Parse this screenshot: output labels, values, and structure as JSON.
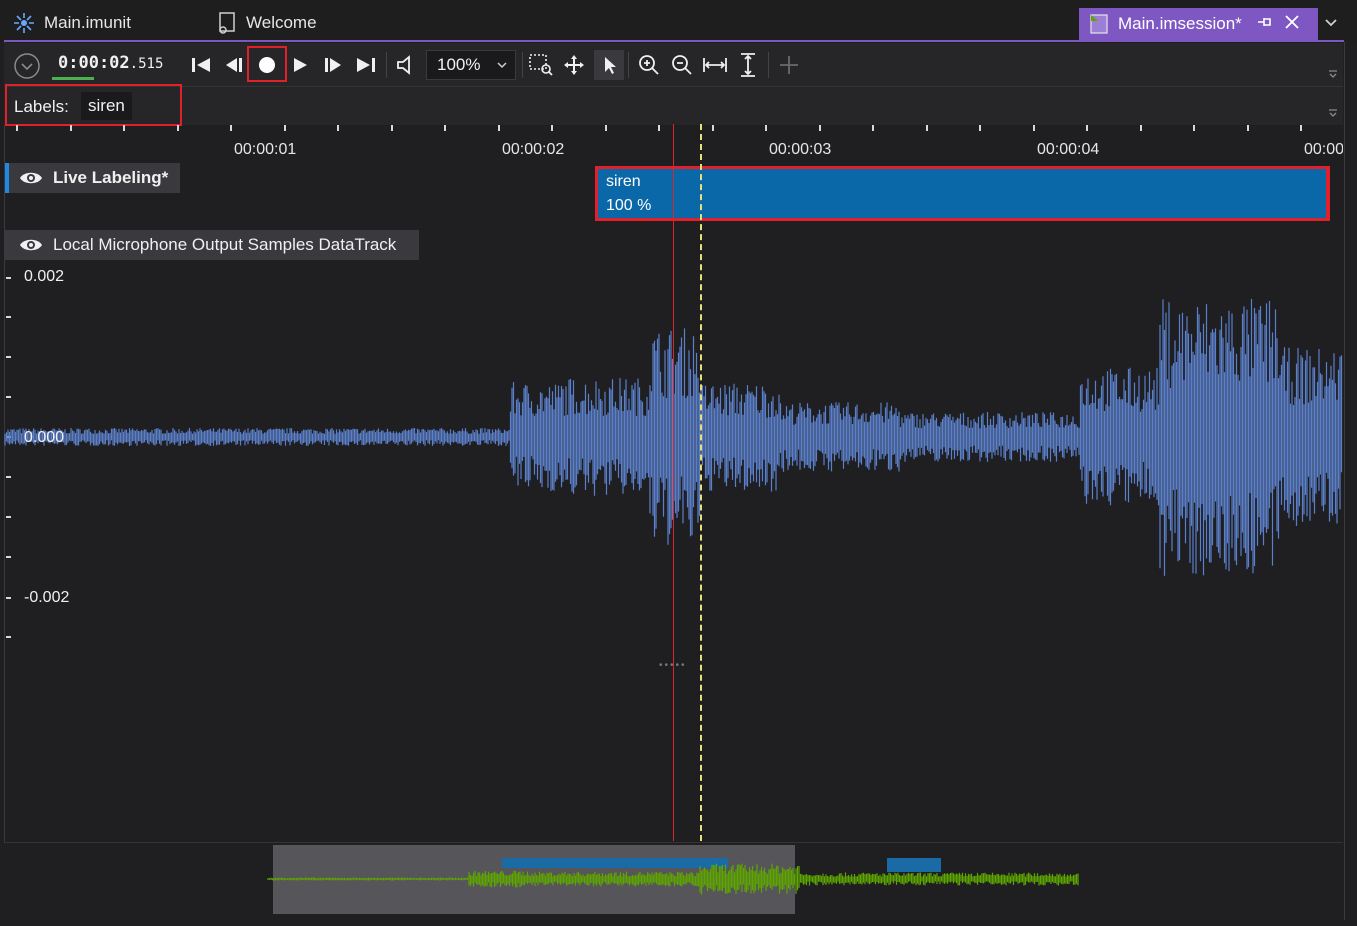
{
  "tabs": [
    {
      "label": "Main.imunit",
      "icon": "unit-icon"
    },
    {
      "label": "Welcome",
      "icon": "welcome-icon"
    },
    {
      "label": "Main.imsession*",
      "icon": "session-icon",
      "active": true
    }
  ],
  "toolbar": {
    "time_main": "0:00:02",
    "time_ms": ".515",
    "zoom": "100%"
  },
  "labels": {
    "caption": "Labels:",
    "chips": [
      "siren"
    ]
  },
  "timeline": {
    "ticks": [
      "00:00:01",
      "00:00:02",
      "00:00:03",
      "00:00:04",
      "00:00"
    ]
  },
  "tracks": {
    "live_labeling": {
      "name": "Live Labeling*",
      "annotation": {
        "label": "siren",
        "confidence": "100 %"
      }
    },
    "datatrack": {
      "name": "Local Microphone Output Samples DataTrack",
      "y_labels": [
        "0.002",
        "0.000",
        "-0.002"
      ]
    }
  },
  "colors": {
    "accent": "#7e57c2",
    "waveform": "#5b7fc8",
    "annotation": "#0a68a8",
    "overview_wave": "#5ea500",
    "highlight": "#e0202a"
  }
}
